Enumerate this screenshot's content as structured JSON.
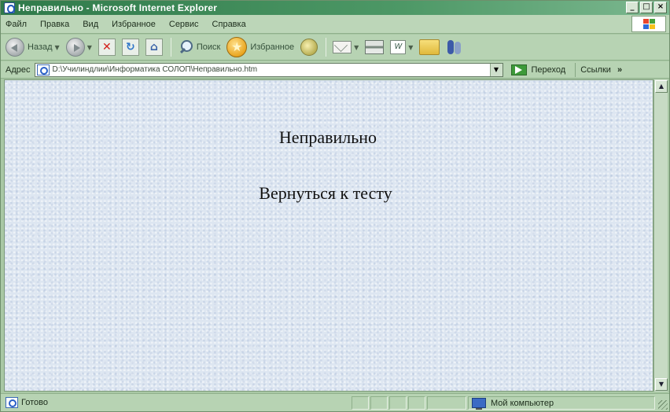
{
  "window": {
    "title": "Неправильно - Microsoft Internet Explorer"
  },
  "menu": {
    "items": [
      "Файл",
      "Правка",
      "Вид",
      "Избранное",
      "Сервис",
      "Справка"
    ]
  },
  "toolbar": {
    "back_label": "Назад",
    "search_label": "Поиск",
    "favorites_label": "Избранное"
  },
  "address": {
    "label": "Адрес",
    "url": "D:\\Училиндлии\\Информатика СОЛОП\\Неправильно.htm",
    "go_label": "Переход",
    "links_label": "Ссылки",
    "links_chevron": "»"
  },
  "page": {
    "heading": "Неправильно",
    "back_link": "Вернуться к тесту"
  },
  "status": {
    "text": "Готово",
    "zone": "Мой компьютер"
  },
  "colors": {
    "title_bar": "#2f7a4a",
    "chrome": "#b7d3b3",
    "content_bg": "#dde6f1"
  }
}
